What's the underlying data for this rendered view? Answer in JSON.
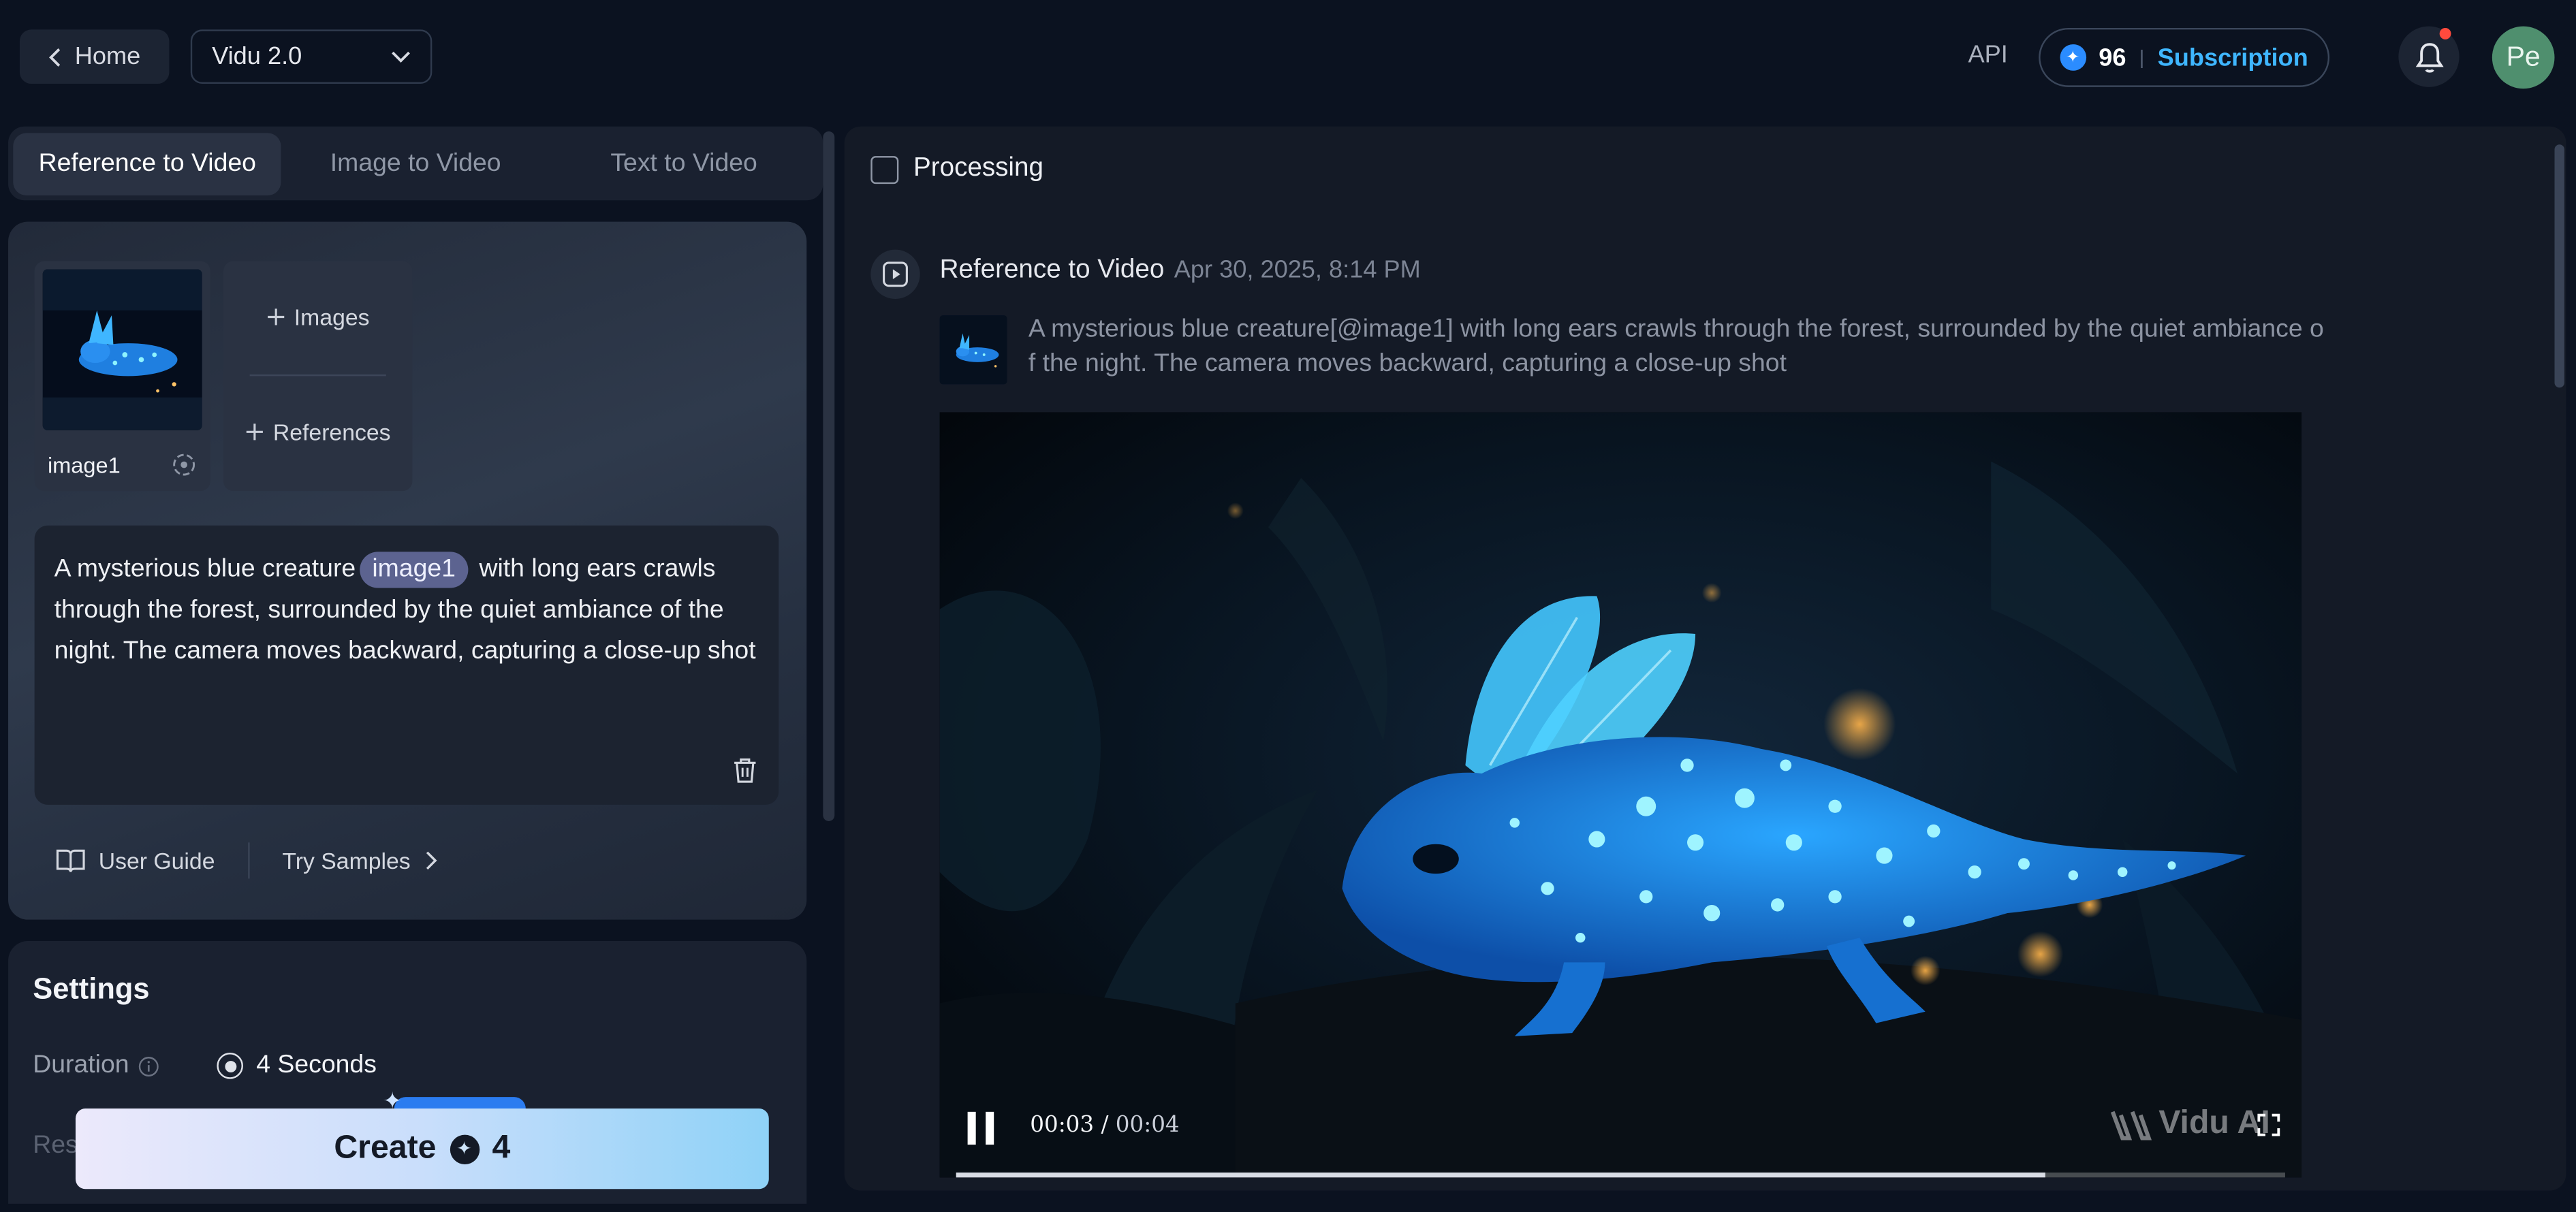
{
  "header": {
    "home_label": "Home",
    "model_value": "Vidu 2.0",
    "api_label": "API",
    "credits": "96",
    "subscription_label": "Subscription",
    "avatar_initials": "Pe"
  },
  "tabs": [
    {
      "label": "Reference to Video",
      "active": true
    },
    {
      "label": "Image to Video",
      "active": false
    },
    {
      "label": "Text to Video",
      "active": false
    }
  ],
  "references": {
    "image_name": "image1",
    "add_images_label": "Images",
    "add_references_label": "References"
  },
  "prompt": {
    "before_chip": "A mysterious blue creature",
    "chip": "image1",
    "after_chip": " with long ears crawls through the forest, surrounded by the quiet ambiance of the night. The camera moves backward, capturing a close-up shot"
  },
  "links": {
    "user_guide": "User Guide",
    "try_samples": "Try Samples"
  },
  "settings": {
    "title": "Settings",
    "duration_label": "Duration",
    "duration_value": "4 Seconds",
    "resolution_label": "Res"
  },
  "create": {
    "label": "Create",
    "cost": "4"
  },
  "results": {
    "processing_label": "Processing",
    "task_type": "Reference to Video",
    "task_time": "Apr 30, 2025, 8:14 PM",
    "task_prompt": "A mysterious blue creature[@image1] with long ears crawls through the forest, surrounded by the quiet ambiance of the night. The camera moves backward, capturing a close-up shot",
    "current_time": "00:03",
    "duration": "00:04",
    "progress_fraction": 0.82,
    "watermark": "Vidu AI"
  },
  "colors": {
    "background": "#0b1220",
    "accent": "#3fb6ff",
    "chip": "#5c6390",
    "notification": "#ff4a3d"
  },
  "icons": [
    "chevron-left-icon",
    "chevron-down-icon",
    "credit-coin-icon",
    "bell-icon",
    "swap-icon",
    "plus-icon",
    "trash-icon",
    "book-icon",
    "chevron-right-icon",
    "info-icon",
    "task-video-icon",
    "pause-icon",
    "fullscreen-icon"
  ]
}
